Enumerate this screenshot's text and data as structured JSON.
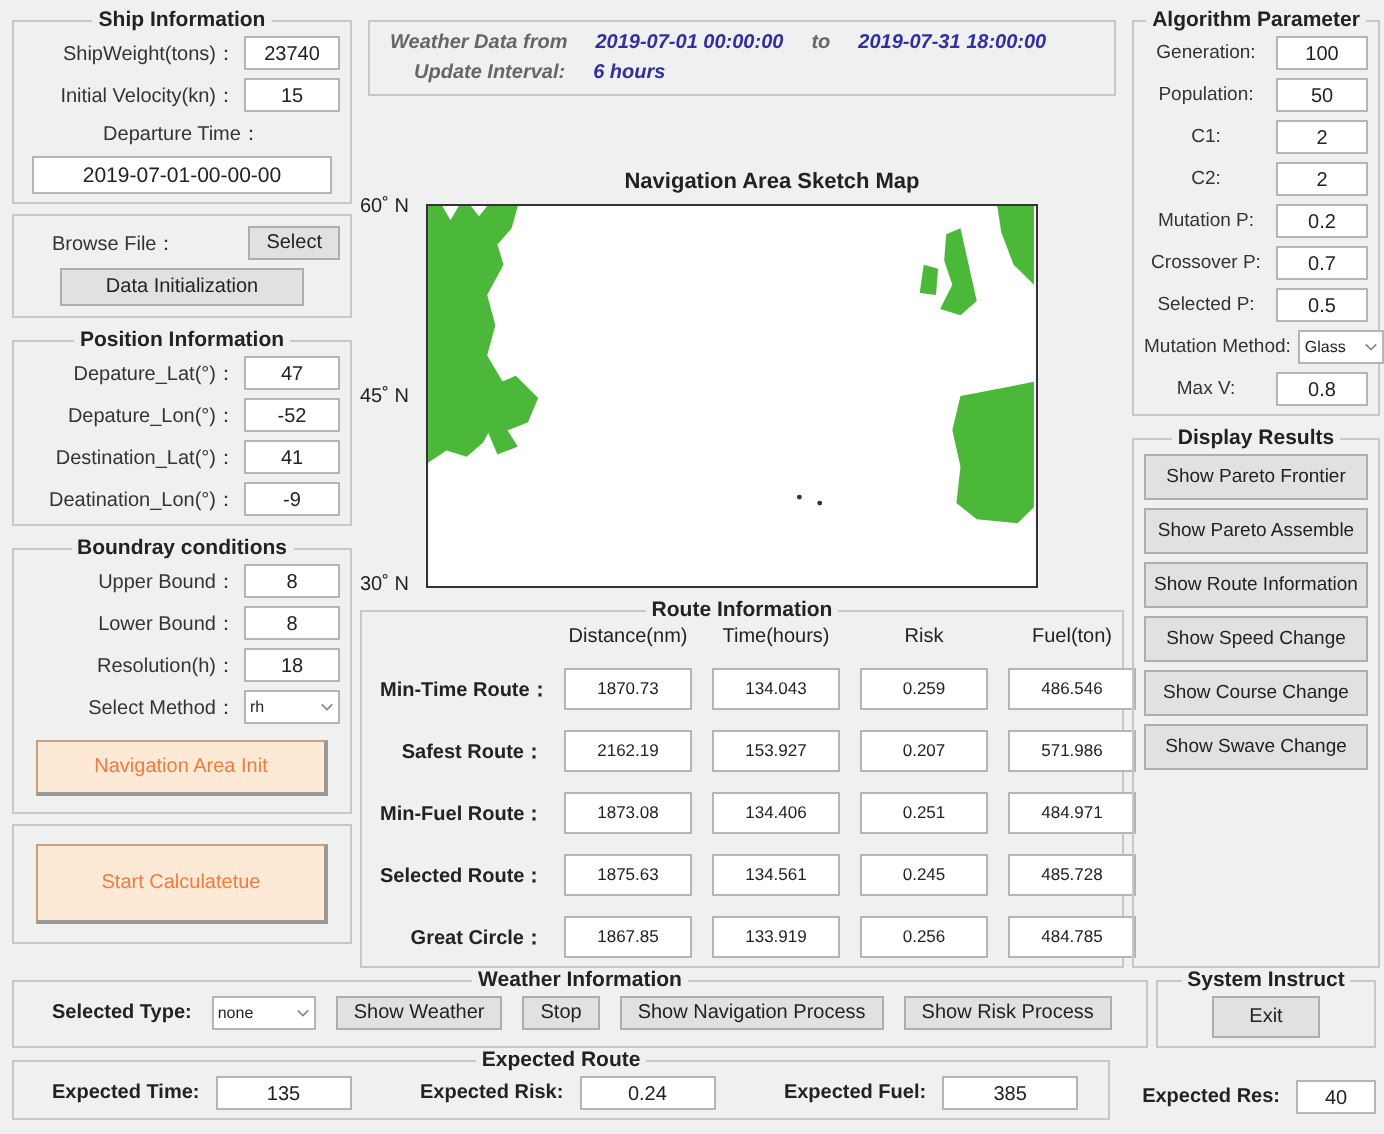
{
  "ship_information": {
    "title": "Ship Information",
    "fields": [
      {
        "label": "ShipWeight(tons)：",
        "value": "23740"
      },
      {
        "label": "Initial Velocity(kn)：",
        "value": "15"
      }
    ],
    "departure_label": "Departure Time：",
    "departure_value": "2019-07-01-00-00-00"
  },
  "browse": {
    "label": "Browse File：",
    "select_button": "Select",
    "init_button": "Data Initialization"
  },
  "position_information": {
    "title": "Position Information",
    "fields": [
      {
        "label": "Depature_Lat(°)：",
        "value": "47"
      },
      {
        "label": "Depature_Lon(°)：",
        "value": "-52"
      },
      {
        "label": "Destination_Lat(°)：",
        "value": "41"
      },
      {
        "label": "Deatination_Lon(°)：",
        "value": "-9"
      }
    ]
  },
  "boundary_conditions": {
    "title": "Boundray conditions",
    "fields": [
      {
        "label": "Upper Bound：",
        "value": "8"
      },
      {
        "label": "Lower Bound：",
        "value": "8"
      },
      {
        "label": "Resolution(h)：",
        "value": "18"
      }
    ],
    "method_label": "Select Method：",
    "method_value": "rh",
    "init_button": "Navigation Area Init"
  },
  "start_button": "Start Calculatetue",
  "weather_data": {
    "from_label": "Weather Data from",
    "start": "2019-07-01 00:00:00",
    "to_label": "to",
    "end": "2019-07-31 18:00:00",
    "interval_label": "Update Interval:",
    "interval": "6 hours"
  },
  "map": {
    "title": "Navigation Area Sketch Map",
    "lat_labels": [
      "60˚ N",
      "45˚ N",
      "30˚ N"
    ]
  },
  "route_information": {
    "title": "Route Information",
    "columns": [
      "Distance(nm)",
      "Time(hours)",
      "Risk",
      "Fuel(ton)"
    ],
    "rows": [
      {
        "label": "Min-Time Route：",
        "cells": [
          "1870.73",
          "134.043",
          "0.259",
          "486.546"
        ]
      },
      {
        "label": "Safest Route：",
        "cells": [
          "2162.19",
          "153.927",
          "0.207",
          "571.986"
        ]
      },
      {
        "label": "Min-Fuel Route：",
        "cells": [
          "1873.08",
          "134.406",
          "0.251",
          "484.971"
        ]
      },
      {
        "label": "Selected Route：",
        "cells": [
          "1875.63",
          "134.561",
          "0.245",
          "485.728"
        ]
      },
      {
        "label": "Great Circle：",
        "cells": [
          "1867.85",
          "133.919",
          "0.256",
          "484.785"
        ]
      }
    ]
  },
  "algorithm_parameter": {
    "title": "Algorithm Parameter",
    "fields": [
      {
        "kind": "input",
        "label": "Generation:",
        "value": "100"
      },
      {
        "kind": "input",
        "label": "Population:",
        "value": "50"
      },
      {
        "kind": "input",
        "label": "C1:",
        "value": "2"
      },
      {
        "kind": "input",
        "label": "C2:",
        "value": "2"
      },
      {
        "kind": "input",
        "label": "Mutation P:",
        "value": "0.2"
      },
      {
        "kind": "input",
        "label": "Crossover P:",
        "value": "0.7"
      },
      {
        "kind": "input",
        "label": "Selected P:",
        "value": "0.5"
      },
      {
        "kind": "dropdown",
        "label": "Mutation Method:",
        "value": "Glass"
      },
      {
        "kind": "input",
        "label": "Max V:",
        "value": "0.8"
      }
    ]
  },
  "display_results": {
    "title": "Display Results",
    "buttons": [
      "Show Pareto Frontier",
      "Show Pareto Assemble",
      "Show Route Information",
      "Show Speed Change",
      "Show Course Change",
      "Show Swave Change"
    ]
  },
  "weather_information": {
    "title": "Weather Information",
    "type_label": "Selected Type:",
    "type_value": "none",
    "buttons": [
      "Show Weather",
      "Stop",
      "Show Navigation Process",
      "Show Risk Process"
    ]
  },
  "system_instruct": {
    "title": "System Instruct",
    "button": "Exit"
  },
  "expected_route": {
    "title": "Expected Route",
    "fields": [
      {
        "label": "Expected Time:",
        "value": "135"
      },
      {
        "label": "Expected Risk:",
        "value": "0.24"
      },
      {
        "label": "Expected Fuel:",
        "value": "385"
      }
    ]
  },
  "expected_res": {
    "label": "Expected Res:",
    "value": "40"
  }
}
